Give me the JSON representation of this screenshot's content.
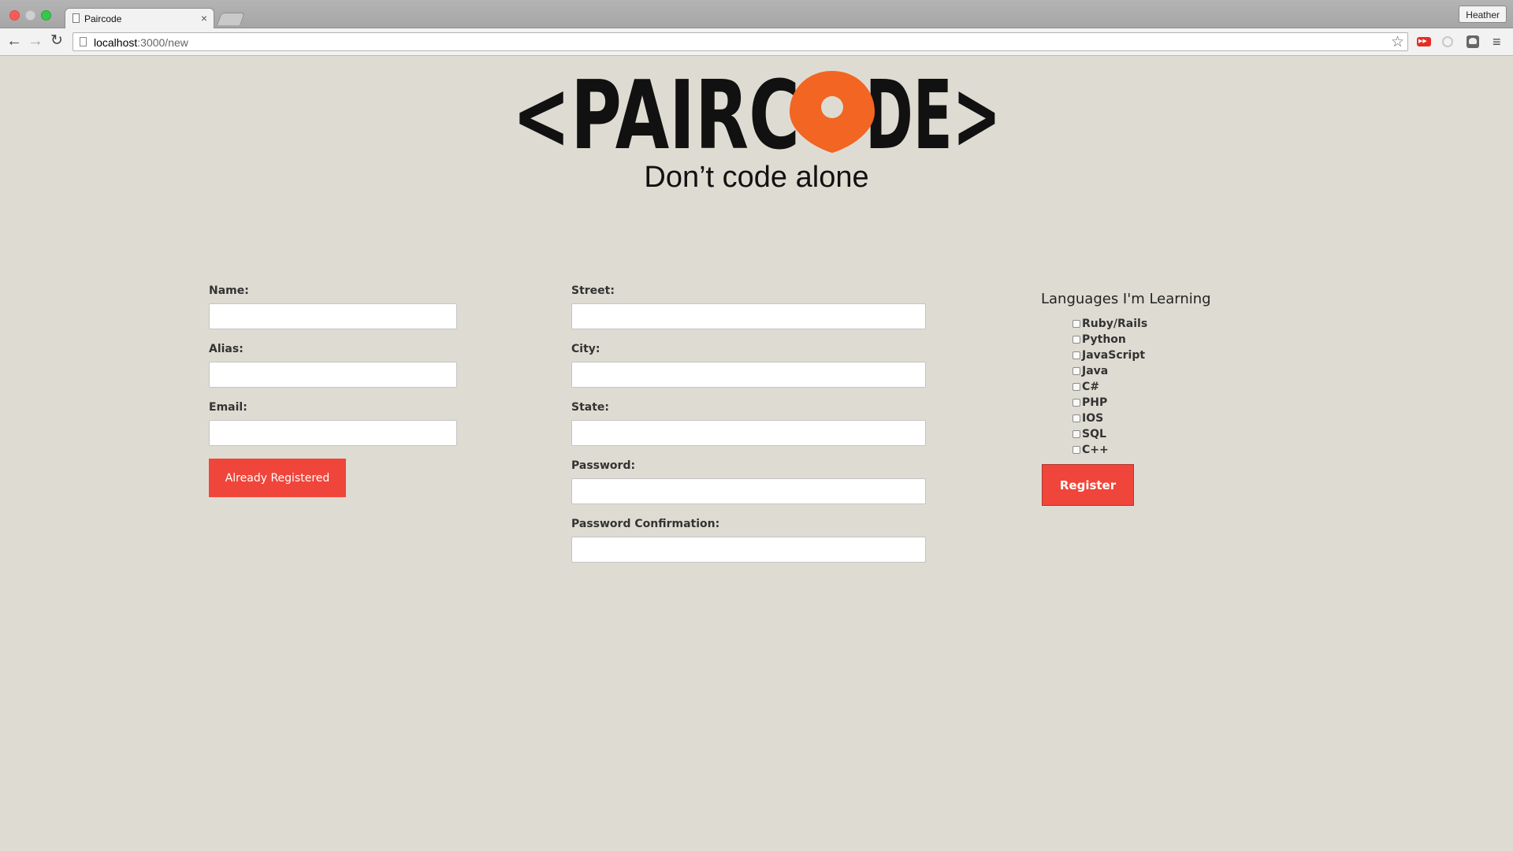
{
  "browser": {
    "tab_title": "Paircode",
    "tab_close": "×",
    "profile_name": "Heather",
    "url_host": "localhost",
    "url_path": ":3000/new",
    "icons": {
      "back": "back-arrow-icon",
      "forward": "forward-arrow-icon",
      "reload": "reload-icon",
      "bookmark": "star-icon",
      "menu": "hamburger-menu-icon"
    }
  },
  "brand": {
    "logo_left": "<PAIRC",
    "logo_right": "DE>",
    "logo_pin_color": "#f26522",
    "tagline": "Don’t code alone"
  },
  "form": {
    "left": {
      "name_label": "Name:",
      "alias_label": "Alias:",
      "email_label": "Email:",
      "already_registered": "Already Registered"
    },
    "middle": {
      "street_label": "Street:",
      "city_label": "City:",
      "state_label": "State:",
      "password_label": "Password:",
      "password_confirmation_label": "Password Confirmation:"
    },
    "languages": {
      "heading": "Languages I'm Learning",
      "items": [
        "Ruby/Rails",
        "Python",
        "JavaScript",
        "Java",
        "C#",
        "PHP",
        "IOS",
        "SQL",
        "C++"
      ]
    },
    "register": "Register"
  },
  "colors": {
    "page_bg": "#dedcd2",
    "accent_red": "#f0453a",
    "logo_orange": "#f26522"
  }
}
